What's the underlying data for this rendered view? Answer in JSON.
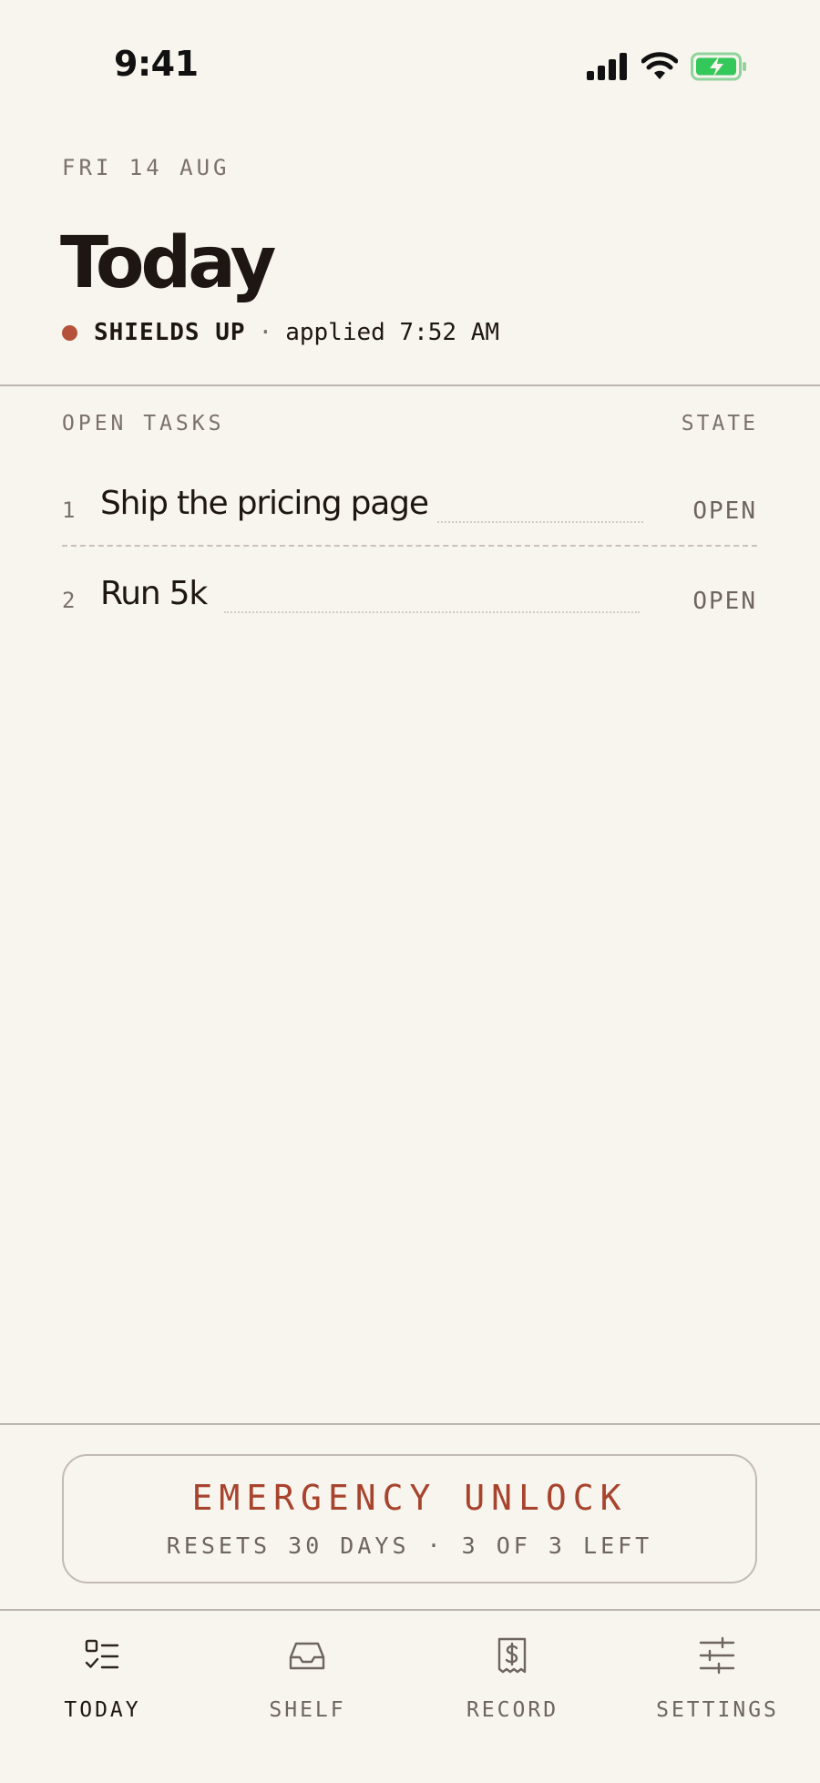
{
  "status_bar": {
    "time": "9:41",
    "icons": [
      "cellular-signal-icon",
      "wifi-icon",
      "battery-charging-icon"
    ],
    "battery_color": "#34c759"
  },
  "header": {
    "date": "FRI 14 AUG",
    "title": "Today",
    "shield_state": "SHIELDS UP",
    "shield_separator": "·",
    "shield_applied": "applied 7:52 AM",
    "shield_color": "#b5533a"
  },
  "tasks": {
    "column_left": "OPEN TASKS",
    "column_right": "STATE",
    "items": [
      {
        "num": "1",
        "title": "Ship the pricing page",
        "state": "OPEN"
      },
      {
        "num": "2",
        "title": "Run 5k",
        "state": "OPEN"
      }
    ]
  },
  "emergency": {
    "label": "EMERGENCY UNLOCK",
    "sub": "RESETS 30 DAYS · 3 OF 3 LEFT",
    "accent": "#a8442d"
  },
  "tab_bar": {
    "tabs": [
      {
        "label": "TODAY",
        "icon": "checklist-icon",
        "active": true
      },
      {
        "label": "SHELF",
        "icon": "inbox-tray-icon",
        "active": false
      },
      {
        "label": "RECORD",
        "icon": "receipt-dollar-icon",
        "active": false
      },
      {
        "label": "SETTINGS",
        "icon": "sliders-icon",
        "active": false
      }
    ]
  }
}
